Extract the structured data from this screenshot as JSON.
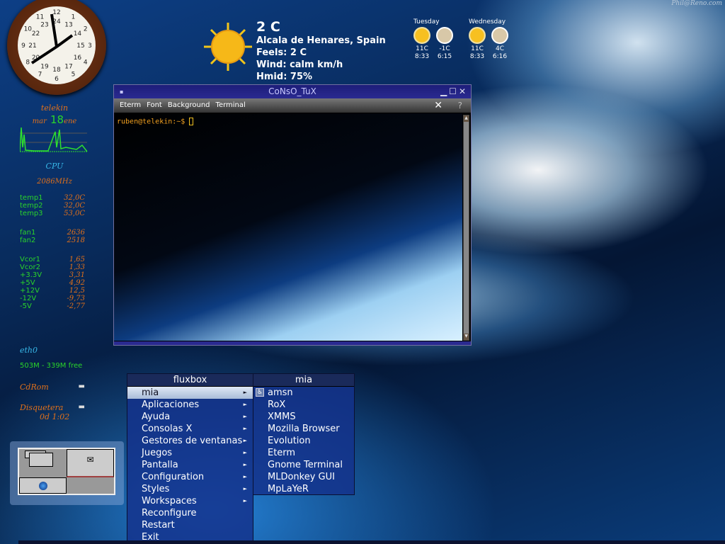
{
  "watermark": "Phil@Reno.com",
  "clock": {
    "numbers_outer": [
      "12",
      "1",
      "2",
      "3",
      "4",
      "5",
      "6",
      "7",
      "8",
      "9",
      "10",
      "11"
    ],
    "numbers_inner": [
      "24",
      "13",
      "14",
      "15",
      "16",
      "17",
      "18",
      "19",
      "20",
      "21",
      "22",
      "23"
    ]
  },
  "weather": {
    "temp": "2 C",
    "location": "Alcala de Henares, Spain",
    "feels": "Feels: 2 C",
    "wind": "Wind: calm km/h",
    "humidity": "Hmid: 75%",
    "forecast": [
      {
        "day": "Tuesday",
        "hi": "11C",
        "lo": "-1C",
        "rise": "8:33",
        "set": "6:15"
      },
      {
        "day": "Wednesday",
        "hi": "11C",
        "lo": "4C",
        "rise": "8:33",
        "set": "6:16"
      }
    ]
  },
  "monitor": {
    "host": "telekin",
    "dow": "mar",
    "day": "18",
    "month": "ene",
    "cpu_label": "CPU",
    "cpu_freq": "2086MHz",
    "temps": [
      {
        "k": "temp1",
        "v": "32,0C"
      },
      {
        "k": "temp2",
        "v": "32,0C"
      },
      {
        "k": "temp3",
        "v": "53,0C"
      }
    ],
    "fans": [
      {
        "k": "fan1",
        "v": "2636"
      },
      {
        "k": "fan2",
        "v": "2518"
      }
    ],
    "volts": [
      {
        "k": "Vcor1",
        "v": "1,65"
      },
      {
        "k": "Vcor2",
        "v": "1,33"
      },
      {
        "k": "+3.3V",
        "v": "3,31"
      },
      {
        "k": "+5V",
        "v": "4,92"
      },
      {
        "k": "+12V",
        "v": "12,5"
      },
      {
        "k": "-12V",
        "v": "-9,73"
      },
      {
        "k": "-5V",
        "v": "-2,77"
      }
    ],
    "net": "eth0",
    "mem": "503M - 339M free",
    "cdrom": "CdRom",
    "floppy": "Disquetera",
    "uptime": "0d  1:02"
  },
  "terminal": {
    "title": "CoNsO_TuX",
    "menus": [
      "Eterm",
      "Font",
      "Background",
      "Terminal"
    ],
    "prompt": "ruben@telekin:~$ "
  },
  "rootmenu": {
    "title": "fluxbox",
    "items": [
      "mia",
      "Aplicaciones",
      "Ayuda",
      "Consolas X",
      "Gestores de ventanas",
      "Juegos",
      "Pantalla",
      "Configuration",
      "Styles",
      "Workspaces",
      "Reconfigure",
      "Restart",
      "Exit"
    ]
  },
  "submenu": {
    "title": "mia",
    "items": [
      "amsn",
      "RoX",
      "XMMS",
      "Mozilla Browser",
      "Evolution",
      "Eterm",
      "Gnome Terminal",
      "MLDonkey GUI",
      "MpLaYeR"
    ]
  }
}
